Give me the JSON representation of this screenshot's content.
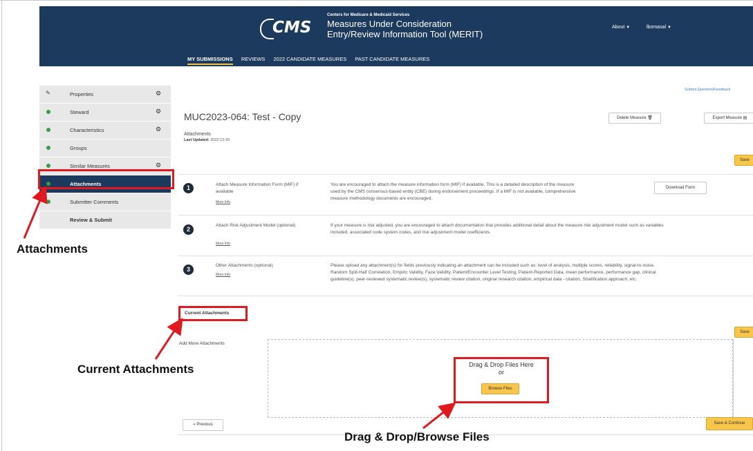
{
  "header": {
    "agency": "Centers for Medicare & Medicaid Services",
    "logo": "CMS",
    "app_title_line1": "Measures Under Consideration",
    "app_title_line2": "Entry/Review Information Tool (MERIT)",
    "about_menu": "About",
    "user_menu": "lbomasal",
    "nav": [
      "MY SUBMISSIONS",
      "REVIEWS",
      "2022 CANDIDATE MEASURES",
      "PAST CANDIDATE MEASURES"
    ],
    "active_nav": "MY SUBMISSIONS"
  },
  "sidebar": {
    "items": [
      {
        "label": "Properties",
        "icon": "pencil-icon",
        "gear": true
      },
      {
        "label": "Steward",
        "icon": "check-dot-icon",
        "gear": true
      },
      {
        "label": "Characteristics",
        "icon": "check-dot-icon",
        "gear": true
      },
      {
        "label": "Groups",
        "icon": "check-dot-icon",
        "gear": false
      },
      {
        "label": "Similar Measures",
        "icon": "check-dot-icon",
        "gear": true
      },
      {
        "label": "Attachments",
        "icon": "check-dot-icon",
        "gear": false,
        "active": true
      },
      {
        "label": "Submitter Comments",
        "icon": "check-dot-icon",
        "gear": false
      },
      {
        "label": "Review & Submit",
        "icon": "",
        "gear": false
      }
    ]
  },
  "main": {
    "submit_question": "Submit Question/Feedback",
    "title": "MUC2023-064: Test - Copy",
    "section": "Attachments",
    "last_updated_label": "Last Updated:",
    "last_updated_value": "2022-12-20",
    "delete_button": "Delete Measure",
    "export_button": "Export Measure",
    "save_button": "Save",
    "rows": [
      {
        "number": "1",
        "title": "Attach Measure Information Form (MIF) if available",
        "more": "More Info",
        "description_lines": [
          "You are encouraged to attach the measure information form (MIF) if available. This is a detailed description of the measure",
          "used by the CMS consensus-based entity (CBE) during endorsement proceedings. If a MIF is not available, comprehensive",
          "measure methodology documents are encouraged."
        ],
        "action": "Download Form"
      },
      {
        "number": "2",
        "title": "Attach Risk Adjustment Model (optional)",
        "more": "More Info",
        "description_lines": [
          "If your measure is risk adjusted, you are encouraged to attach documentation that provides additional detail about the measure risk adjustment model such as variables",
          "included, associated code system codes, and risk adjustment model coefficients."
        ]
      },
      {
        "number": "3",
        "title": "Other Attachments (optional)",
        "more": "More Info",
        "description_lines": [
          "Please upload any attachment(s) for fields previously indicating an attachment can be included such as: level of analysis, multiple scores, reliability, signal-to-noise,",
          "Random Split-Half Correlation, Empiric Validity, Face Validity, Patient/Encounter Level Testing, Patient-Reported Data, mean performance, performance gap, clinical",
          "guideline(s), peer-reviewed systematic review(s), systematic review citation, original research citation, empirical data - citation, Stratification approach, etc."
        ]
      }
    ],
    "current_attachments": "Current Attachments",
    "add_more": "Add More Attachments",
    "drag_line1": "Drag & Drop Files Here",
    "drag_line2": "or",
    "browse_button": "Browse Files",
    "save_button_2": "Save",
    "previous_button": "« Previous",
    "save_continue_button": "Save & Continue"
  },
  "callouts": {
    "attachments": "Attachments",
    "current_attachments": "Current Attachments",
    "drag_drop": "Drag & Drop/Browse Files"
  },
  "colors": {
    "header_bg": "#1c3a5e",
    "accent_yellow": "#f8c64a",
    "highlight_red": "#e1191f",
    "status_green": "#3a9b4a"
  }
}
